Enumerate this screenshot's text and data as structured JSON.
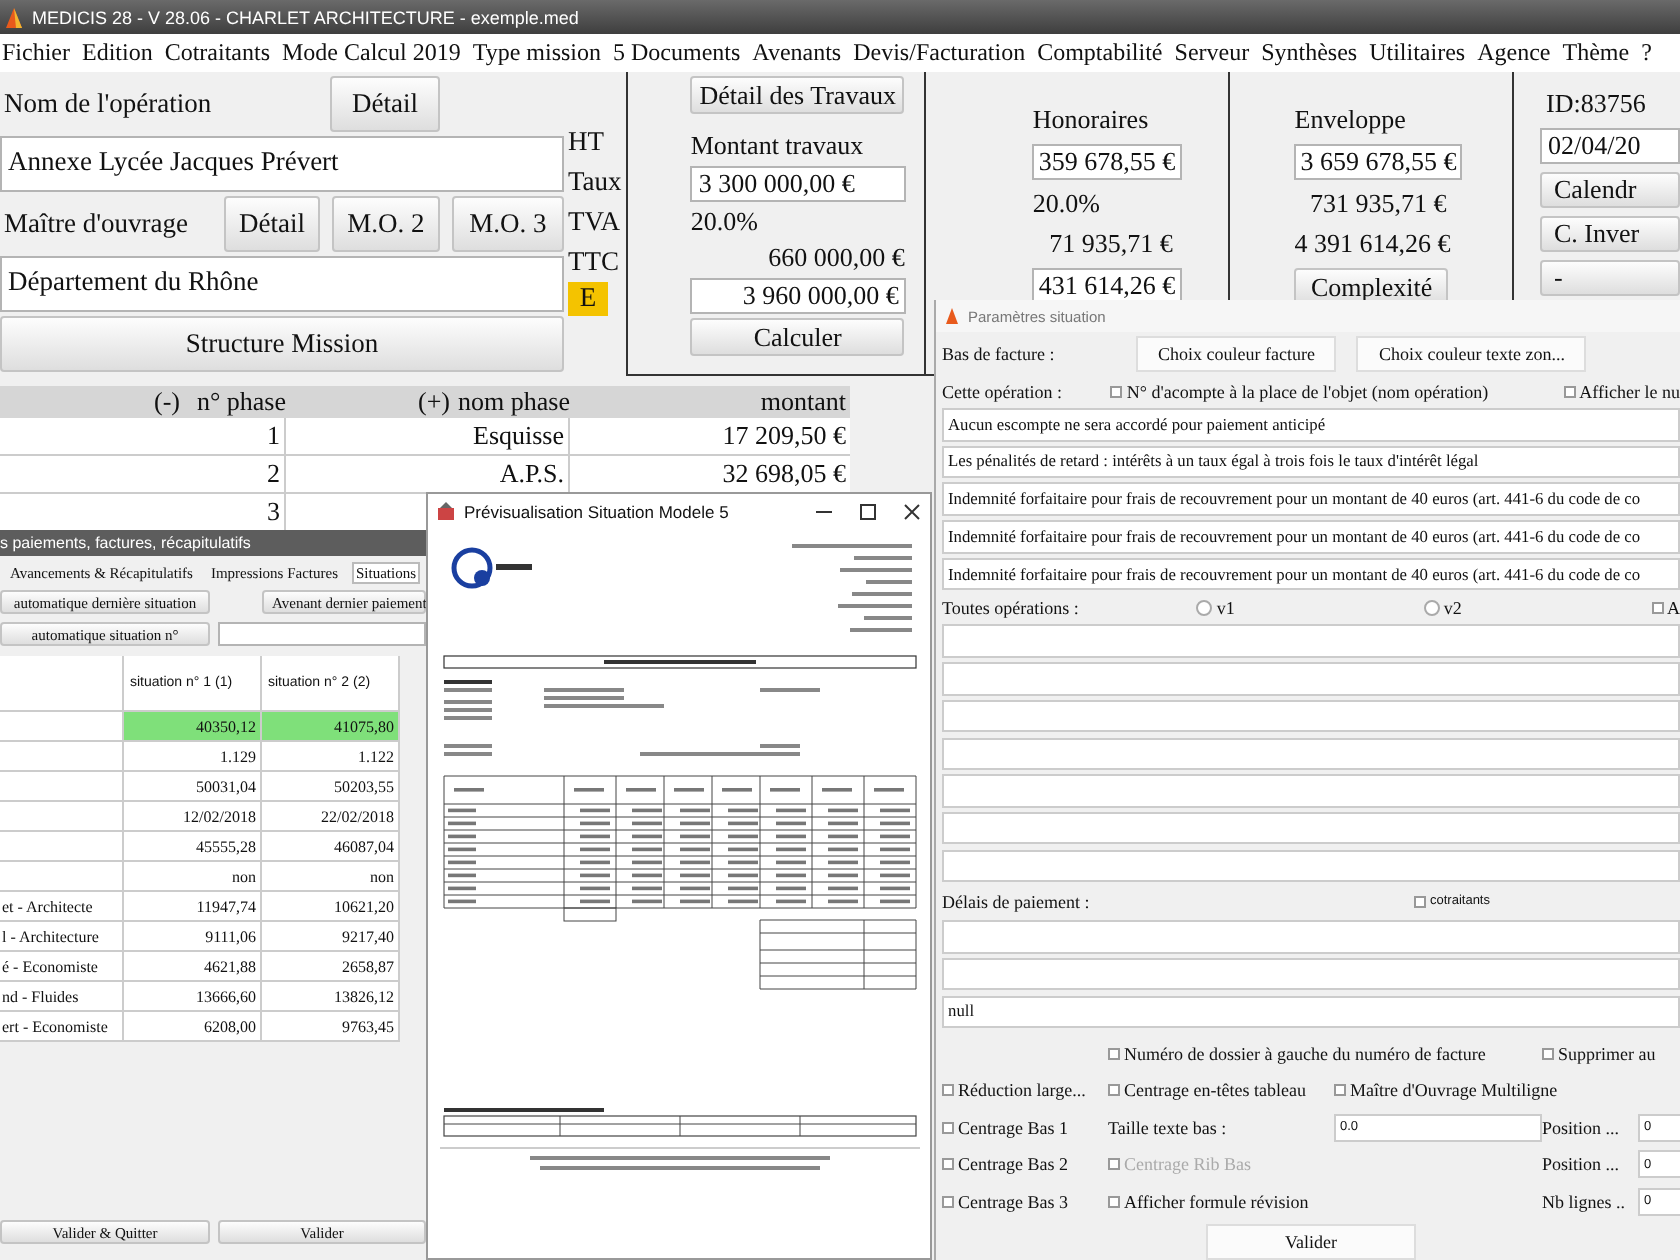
{
  "window": {
    "title": "MEDICIS 28 - V 28.06 - CHARLET ARCHITECTURE - exemple.med"
  },
  "menu": [
    "Fichier",
    "Edition",
    "Cotraitants",
    "Mode Calcul 2019",
    "Type mission",
    "5 Documents",
    "Avenants",
    "Devis/Facturation",
    "Comptabilité",
    "Serveur",
    "Synthèses",
    "Utilitaires",
    "Agence",
    "Thème",
    "?"
  ],
  "operation": {
    "name_label": "Nom de l'opération",
    "name_button": "Détail",
    "name_value": "Annexe Lycée Jacques Prévert",
    "owner_label": "Maître d'ouvrage",
    "owner_buttons": [
      "Détail",
      "M.O. 2",
      "M.O. 3"
    ],
    "owner_value": "Département du Rhône",
    "structure_button": "Structure Mission"
  },
  "amount_labels": [
    "HT",
    "Taux",
    "TVA",
    "TTC"
  ],
  "mode_badge": "E",
  "works": {
    "button": "Détail des Travaux",
    "label": "Montant travaux",
    "ht": "3 300 000,00 €",
    "rate": "20.0%",
    "tva": "660 000,00 €",
    "ttc": "3 960 000,00 €",
    "calc_button": "Calculer"
  },
  "fees": {
    "label": "Honoraires",
    "ht": "359 678,55 €",
    "rate": "20.0%",
    "tva": "71 935,71 €",
    "ttc": "431 614,26 €"
  },
  "envelope": {
    "label": "Enveloppe",
    "ht": "3 659 678,55 €",
    "tva": "731 935,71 €",
    "ttc": "4 391 614,26 €",
    "button": "Complexité"
  },
  "id_panel": {
    "id": "ID:83756",
    "date": "02/04/20",
    "buttons": [
      "Calendr",
      "C. Inver",
      "-"
    ]
  },
  "phases": {
    "columns": [
      "(-)",
      "n° phase",
      "(+)",
      "nom phase",
      "montant"
    ],
    "rows": [
      {
        "number": "1",
        "name": "Esquisse",
        "amount": "17 209,50 €"
      },
      {
        "number": "2",
        "name": "A.P.S.",
        "amount": "32 698,05 €"
      },
      {
        "number": "3"
      }
    ]
  },
  "payments": {
    "title": "s paiements, factures, récapitulatifs",
    "tabs": [
      {
        "label": "Avancements & Récapitulatifs",
        "selected": false
      },
      {
        "label": "Impressions Factures",
        "selected": false
      },
      {
        "label": "Situations",
        "selected": true
      }
    ],
    "last_button": "automatique dernière situation",
    "amendment_button": "Avenant dernier paiement",
    "auto_button": "automatique situation n°",
    "columns": [
      "situation n° 1 (1)",
      "situation n° 2 (2)"
    ],
    "rows": [
      {
        "values": [
          "40350,12",
          "41075,80"
        ],
        "highlight": true
      },
      {
        "values": [
          "1.129",
          "1.122"
        ],
        "highlight": false
      },
      {
        "values": [
          "50031,04",
          "50203,55"
        ],
        "highlight": false
      },
      {
        "values": [
          "12/02/2018",
          "22/02/2018"
        ],
        "highlight": false
      },
      {
        "values": [
          "45555,28",
          "46087,04"
        ],
        "highlight": false
      },
      {
        "values": [
          "non",
          "non"
        ],
        "highlight": false
      },
      {
        "label": "et - Architecte",
        "values": [
          "11947,74",
          "10621,20"
        ],
        "highlight": false
      },
      {
        "label": "l - Architecture",
        "values": [
          "9111,06",
          "9217,40"
        ],
        "highlight": false
      },
      {
        "label": "é - Economiste",
        "values": [
          "4621,88",
          "2658,87"
        ],
        "highlight": false
      },
      {
        "label": "nd - Fluides",
        "values": [
          "13666,60",
          "13826,12"
        ],
        "highlight": false
      },
      {
        "label": "ert - Economiste",
        "values": [
          "6208,00",
          "9763,45"
        ],
        "highlight": false
      }
    ],
    "buttons": [
      "Valider & Quitter",
      "Valider"
    ]
  },
  "preview": {
    "title": "Prévisualisation Situation Modele 5"
  },
  "params": {
    "title": "Paramètres situation",
    "footer_label": "Bas de facture :",
    "color_buttons": [
      "Choix couleur facture",
      "Choix couleur texte zon..."
    ],
    "operation_label": "Cette opération :",
    "operation_checks": [
      {
        "label": "N° d'acompte à la place de l'objet (nom opération)",
        "checked": false
      },
      {
        "label": "Afficher le nu",
        "checked": false
      }
    ],
    "operation_lines": [
      "Aucun escompte ne sera accordé pour paiement anticipé",
      "Les pénalités de retard : intérêts à un taux égal à trois fois le taux d'intérêt légal",
      "Indemnité forfaitaire pour frais de recouvrement pour un montant de 40 euros (art. 441-6 du code de co",
      "Indemnité forfaitaire pour frais de recouvrement pour un montant de 40 euros (art. 441-6 du code de co",
      "Indemnité forfaitaire pour frais de recouvrement pour un montant de 40 euros (art. 441-6 du code de co"
    ],
    "all_label": "Toutes opérations :",
    "all_radios": [
      {
        "label": "v1",
        "selected": false
      },
      {
        "label": "v2",
        "selected": false
      }
    ],
    "all_check": {
      "label": "A",
      "checked": false
    },
    "delay_label": "Délais de paiement :",
    "cotraitants": {
      "label": "cotraitants",
      "checked": false
    },
    "delay_value": "null",
    "folder_number": {
      "label": "Numéro de dossier à gauche du numéro de facture",
      "checked": false
    },
    "remove": {
      "label": "Supprimer au",
      "checked": false
    },
    "reduce": {
      "label": "Réduction large...",
      "checked": false
    },
    "center_headers": {
      "label": "Centrage en-têtes tableau",
      "checked": false
    },
    "owner_multiline": {
      "label": "Maître d'Ouvrage Multiligne",
      "checked": false
    },
    "center_bottom": [
      {
        "label": "Centrage Bas 1",
        "checked": false
      },
      {
        "label": "Centrage Bas 2",
        "checked": false
      },
      {
        "label": "Centrage Bas 3",
        "checked": false
      }
    ],
    "text_size": {
      "label": "Taille texte bas :",
      "value": "0.0"
    },
    "center_rib": {
      "label": "Centrage Rib Bas",
      "checked": false,
      "disabled": true
    },
    "show_revision": {
      "label": "Afficher formule révision",
      "checked": false,
      "disabled": false
    },
    "positions": [
      {
        "label": "Position ...",
        "value": "0"
      },
      {
        "label": "Position ...",
        "value": "0"
      },
      {
        "label": "Nb lignes ..",
        "value": "0"
      }
    ],
    "validate": "Valider"
  }
}
